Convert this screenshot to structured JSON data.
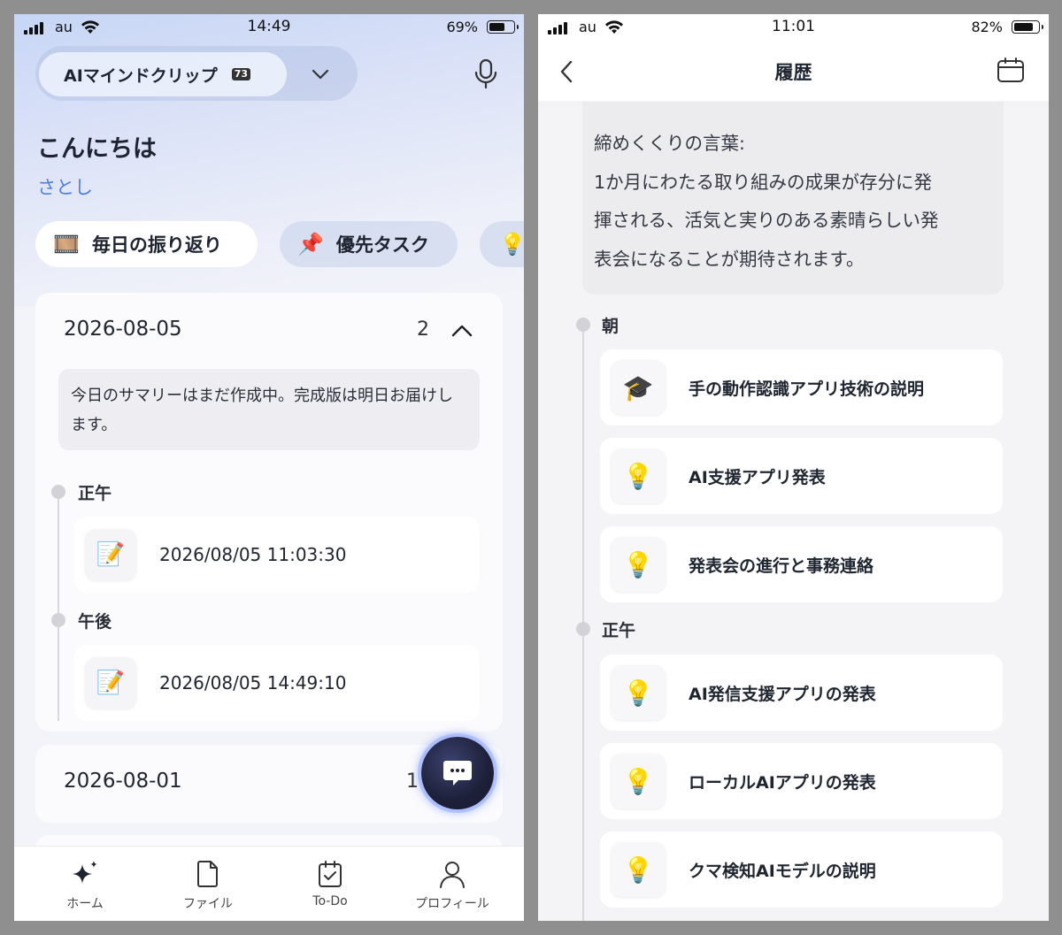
{
  "left": {
    "status": {
      "carrier": "au",
      "time": "14:49",
      "battery": "69%",
      "battery_level": 0.69
    },
    "header": {
      "app_name": "AIマインドクリップ",
      "app_badge": "73"
    },
    "greeting": "こんにちは",
    "user_name": "さとし",
    "chips": [
      {
        "icon": "🎞️",
        "label": "毎日の振り返り"
      },
      {
        "icon": "📌",
        "label": "優先タスク"
      },
      {
        "icon": "💡",
        "label": ""
      }
    ],
    "cards": [
      {
        "date": "2026-08-05",
        "count": "2",
        "summary": "今日のサマリーはまだ作成中。完成版は明日お届けします。",
        "sections": [
          {
            "label": "正午",
            "entry_icon": "📝",
            "entry": "2026/08/05 11:03:30"
          },
          {
            "label": "午後",
            "entry_icon": "📝",
            "entry": "2026/08/05 14:49:10"
          }
        ]
      },
      {
        "date": "2026-08-01",
        "count": "1"
      }
    ],
    "tabs": [
      {
        "icon": "sparkle-icon",
        "label": "ホーム"
      },
      {
        "icon": "file-icon",
        "label": "ファイル"
      },
      {
        "icon": "todo-icon",
        "label": "To-Do"
      },
      {
        "icon": "person-icon",
        "label": "プロフィール"
      }
    ]
  },
  "right": {
    "status": {
      "carrier": "au",
      "time": "11:01",
      "battery": "82%",
      "battery_level": 0.82
    },
    "title": "履歴",
    "quote": {
      "heading": "締めくくりの言葉:",
      "lines": [
        "1か月にわたる取り組みの成果が存分に発",
        "揮される、活気と実りのある素晴らしい発",
        "表会になることが期待されます。"
      ]
    },
    "sections": [
      {
        "label": "朝",
        "items": [
          {
            "icon": "🎓",
            "title": "手の動作認識アプリ技術の説明"
          },
          {
            "icon": "💡",
            "title": "AI支援アプリ発表"
          },
          {
            "icon": "💡",
            "title": "発表会の進行と事務連絡"
          }
        ]
      },
      {
        "label": "正午",
        "items": [
          {
            "icon": "💡",
            "title": "AI発信支援アプリの発表"
          },
          {
            "icon": "💡",
            "title": "ローカルAIアプリの発表"
          },
          {
            "icon": "💡",
            "title": "クマ検知AIモデルの説明"
          }
        ]
      }
    ]
  }
}
